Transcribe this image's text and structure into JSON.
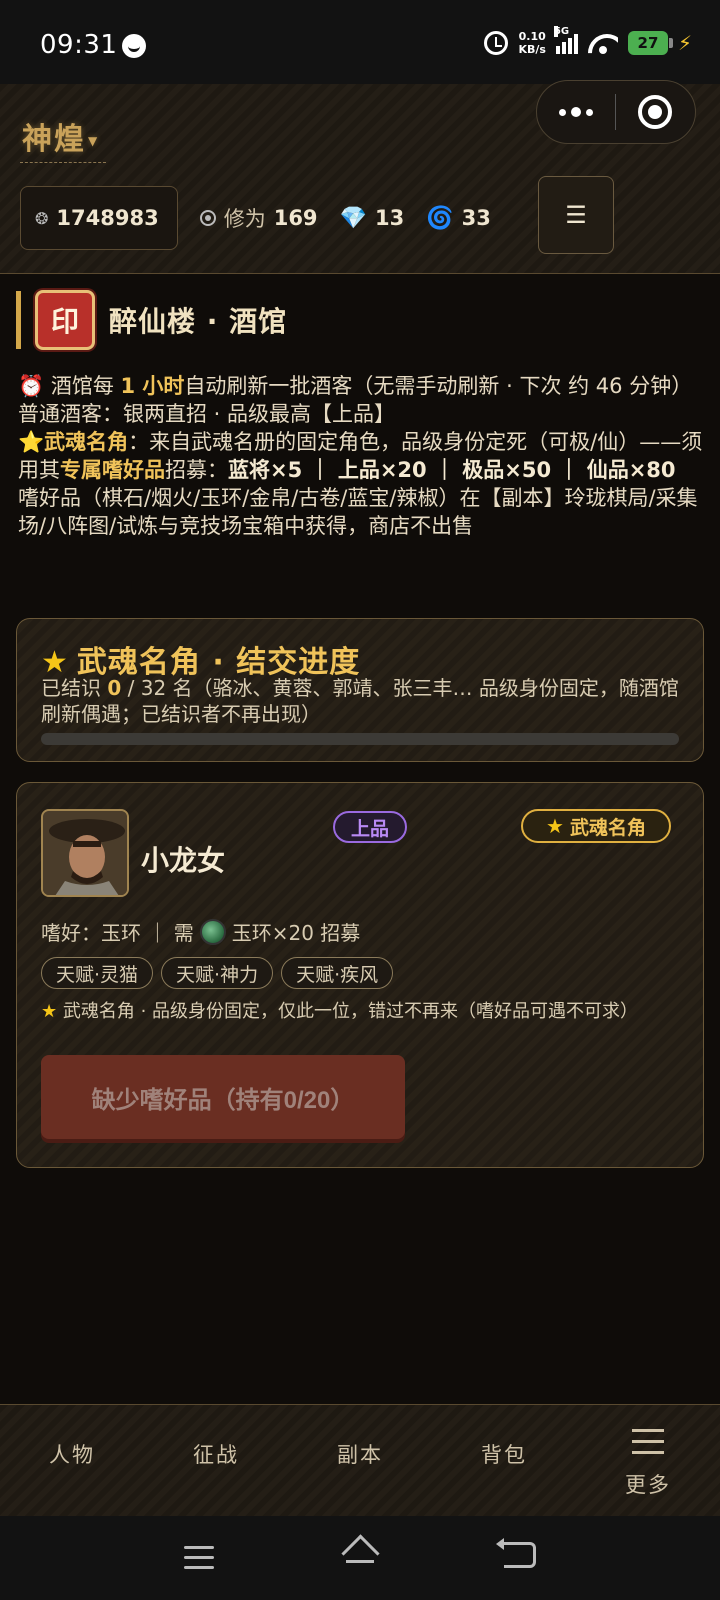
{
  "status": {
    "time": "09:31",
    "net_speed_value": "0.10",
    "net_speed_unit": "KB/s",
    "signal_type": "5G",
    "battery": "27"
  },
  "header": {
    "server_name": "神煌",
    "resources": {
      "silver": "1748983",
      "xiuwei_label": "修为",
      "xiuwei": "169",
      "gems": "13",
      "swirl": "33"
    },
    "menu_icon": "☰"
  },
  "section": {
    "seal": "印",
    "title": "醉仙楼 · 酒馆"
  },
  "info": {
    "line1_a": "⏰ 酒馆每 ",
    "line1_hl": "1 小时",
    "line1_b": "自动刷新一批酒客（无需手动刷新 · 下次 约 46 分钟）",
    "line2": "普通酒客：银两直招 · 品级最高【上品】",
    "line3_hl": "⭐武魂名角",
    "line3_a": "：来自武魂名册的固定角色，品级身份定死（可极/仙）——须用其",
    "line3_hl2": "专属嗜好品",
    "line3_b": "招募：",
    "line3_costs": "蓝将×5 ｜ 上品×20 ｜ 极品×50 ｜ 仙品×80",
    "line4": "嗜好品（棋石/烟火/玉环/金帛/古卷/蓝宝/辣椒）在【副本】玲珑棋局/采集场/八阵图/试炼与竞技场宝箱中获得，商店不出售"
  },
  "progress": {
    "title": "武魂名角 · 结交进度",
    "desc_a": "已结识 ",
    "known": "0",
    "desc_b": " / 32 名（骆冰、黄蓉、郭靖、张三丰… 品级身份固定，随酒馆刷新偶遇；已结识者不再出现）",
    "value": 0
  },
  "character": {
    "name": "小龙女",
    "rank": "上品",
    "famous_badge": "武魂名角",
    "hobby_label": "嗜好：玉环 ｜ 需",
    "hobby_req": "玉环×20 招募",
    "talents": [
      "天赋·灵猫",
      "天赋·神力",
      "天赋·疾风"
    ],
    "note": "武魂名角 · 品级身份固定，仅此一位，错过不再来（嗜好品可遇不可求）",
    "button": "缺少嗜好品（持有0/20）"
  },
  "tabs": [
    "人物",
    "征战",
    "副本",
    "背包",
    "更多"
  ],
  "colors": {
    "gold": "#f0c35a",
    "rank_purple": "#b98af5",
    "button_disabled": "#6a2e22"
  }
}
